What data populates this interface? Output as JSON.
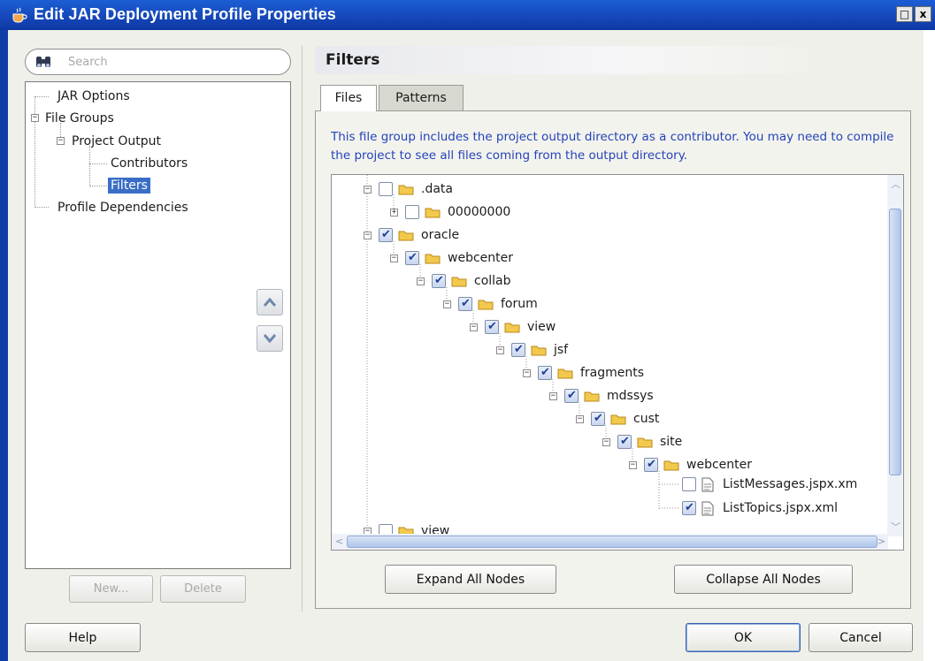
{
  "window": {
    "title": "Edit JAR Deployment Profile Properties",
    "maximize_glyph": "□",
    "close_glyph": "x"
  },
  "search": {
    "placeholder": "Search"
  },
  "nav": {
    "items": [
      {
        "label": "JAR Options"
      },
      {
        "label": "File Groups"
      },
      {
        "label": "Project Output"
      },
      {
        "label": "Contributors"
      },
      {
        "label": "Filters",
        "selected": true
      },
      {
        "label": "Profile Dependencies"
      }
    ],
    "new_label": "New...",
    "delete_label": "Delete"
  },
  "panel": {
    "title": "Filters",
    "tabs": [
      {
        "label": "Files",
        "active": true
      },
      {
        "label": "Patterns",
        "active": false
      }
    ],
    "info": "This file group includes the project output directory as a contributor.  You may need to compile the project to see all files coming from the output directory."
  },
  "file_tree": [
    {
      "label": ".data",
      "checked": false,
      "type": "folder"
    },
    {
      "label": "00000000",
      "checked": false,
      "type": "folder"
    },
    {
      "label": "oracle",
      "checked": true,
      "type": "folder"
    },
    {
      "label": "webcenter",
      "checked": true,
      "type": "folder"
    },
    {
      "label": "collab",
      "checked": true,
      "type": "folder"
    },
    {
      "label": "forum",
      "checked": true,
      "type": "folder"
    },
    {
      "label": "view",
      "checked": true,
      "type": "folder"
    },
    {
      "label": "jsf",
      "checked": true,
      "type": "folder"
    },
    {
      "label": "fragments",
      "checked": true,
      "type": "folder"
    },
    {
      "label": "mdssys",
      "checked": true,
      "type": "folder"
    },
    {
      "label": "cust",
      "checked": true,
      "type": "folder"
    },
    {
      "label": "site",
      "checked": true,
      "type": "folder"
    },
    {
      "label": "webcenter",
      "checked": true,
      "type": "folder"
    },
    {
      "label": "ListMessages.jspx.xm",
      "checked": false,
      "type": "file"
    },
    {
      "label": "ListTopics.jspx.xml",
      "checked": true,
      "type": "file"
    },
    {
      "label": "view",
      "checked": false,
      "type": "folder"
    }
  ],
  "buttons": {
    "expand_all": "Expand All Nodes",
    "collapse_all": "Collapse All Nodes",
    "help": "Help",
    "ok": "OK",
    "cancel": "Cancel"
  },
  "colors": {
    "titlebar": "#1546b8",
    "selection": "#3a6ec6",
    "info_text": "#2343b8"
  }
}
